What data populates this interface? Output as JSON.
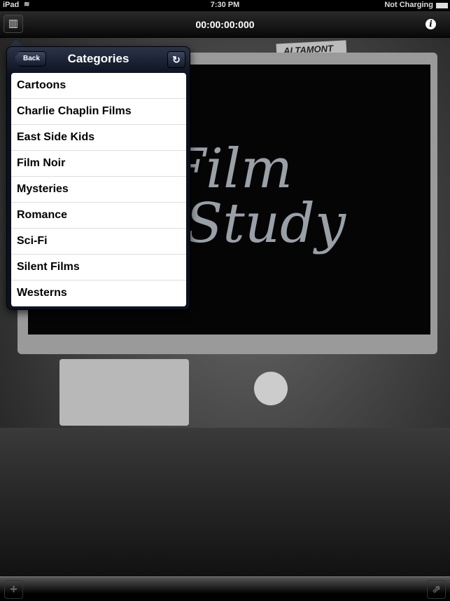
{
  "status": {
    "device": "iPad",
    "time": "7:30 PM",
    "battery": "Not Charging"
  },
  "nav": {
    "timer": "00:00:00:000",
    "left_icon": "film-panel-icon",
    "right_icon": "info-icon"
  },
  "background": {
    "sign": "ALTAMONT",
    "logo_line1": "Film",
    "logo_line2": "Study"
  },
  "popover": {
    "back_label": "Back",
    "title": "Categories",
    "refresh_icon": "refresh-icon",
    "items": [
      "Cartoons",
      "Charlie Chaplin Films",
      "East Side Kids",
      "Film Noir",
      "Mysteries",
      "Romance",
      "Sci-Fi",
      "Silent Films",
      "Westerns"
    ]
  },
  "toolbar": {
    "left_icon": "plus-icon",
    "right_icon": "share-icon"
  }
}
